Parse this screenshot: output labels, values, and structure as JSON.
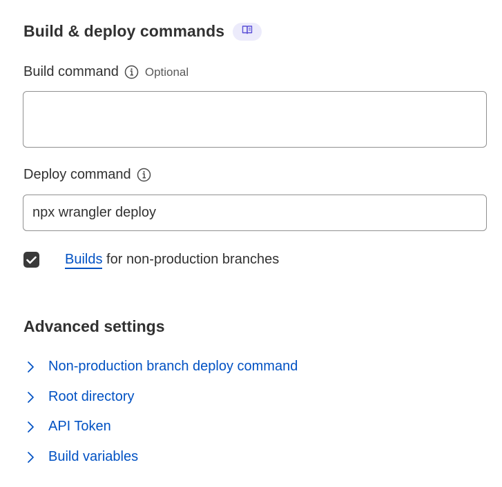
{
  "build_deploy": {
    "title": "Build & deploy commands",
    "docs_icon": "book-open-icon",
    "build_command": {
      "label": "Build command",
      "optional": "Optional",
      "value": "",
      "info_icon": "info-icon"
    },
    "deploy_command": {
      "label": "Deploy command",
      "value": "npx wrangler deploy",
      "info_icon": "info-icon"
    },
    "builds_checkbox": {
      "checked": true,
      "link_text": "Builds",
      "text": " for non-production branches"
    }
  },
  "advanced": {
    "title": "Advanced settings",
    "items": [
      {
        "label": "Non-production branch deploy command"
      },
      {
        "label": "Root directory"
      },
      {
        "label": "API Token"
      },
      {
        "label": "Build variables"
      }
    ]
  },
  "colors": {
    "link": "#0051c3",
    "text": "#313131",
    "badge_bg": "#ecebfb",
    "badge_icon": "#5a4fd6",
    "checkbox": "#3a3a3a"
  }
}
